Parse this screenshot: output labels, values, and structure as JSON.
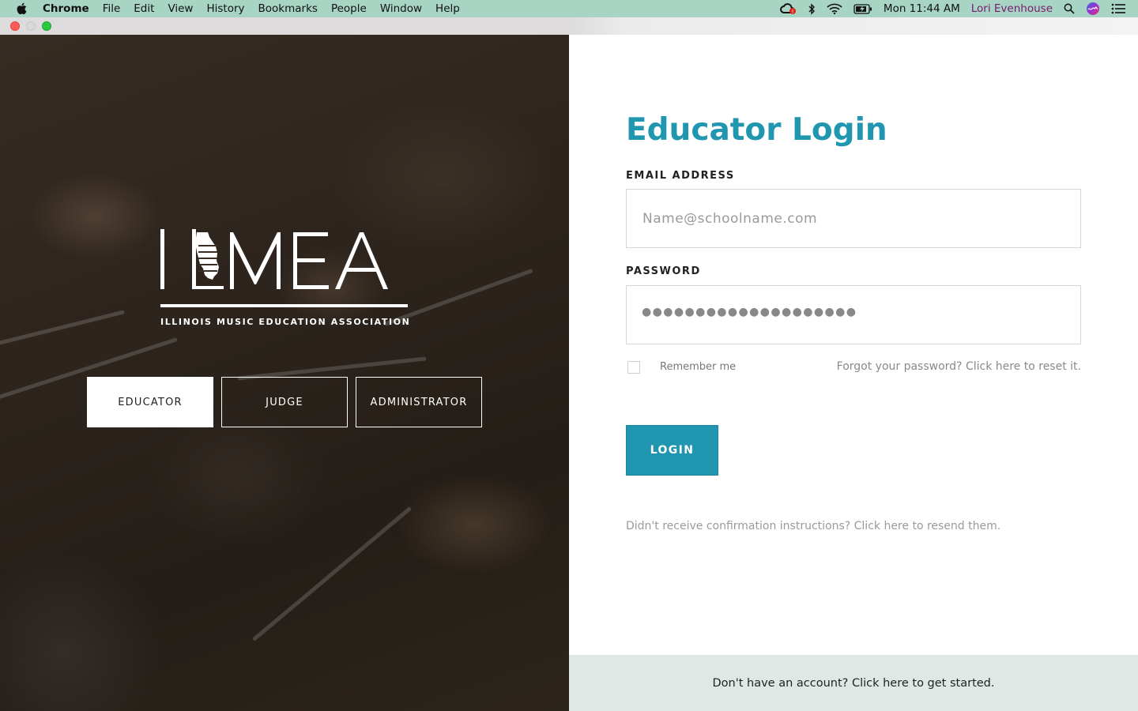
{
  "menubar": {
    "app_name": "Chrome",
    "items": [
      "File",
      "Edit",
      "View",
      "History",
      "Bookmarks",
      "People",
      "Window",
      "Help"
    ],
    "clock": "Mon 11:44 AM",
    "user": "Lori Evenhouse",
    "icons": [
      "apple-icon",
      "creative-cloud-icon",
      "bluetooth-icon",
      "wifi-icon",
      "battery-icon",
      "spotlight-search-icon",
      "siri-icon",
      "notification-center-icon"
    ]
  },
  "hero": {
    "logo_text": "ILMEA",
    "tagline": "ILLINOIS MUSIC EDUCATION ASSOCIATION",
    "roles": [
      {
        "label": "EDUCATOR",
        "active": true
      },
      {
        "label": "JUDGE",
        "active": false
      },
      {
        "label": "ADMINISTRATOR",
        "active": false
      }
    ]
  },
  "login": {
    "title": "Educator Login",
    "email_label": "EMAIL ADDRESS",
    "email_placeholder": "Name@schoolname.com",
    "password_label": "PASSWORD",
    "password_masked": "●●●●●●●●●●●●●●●●●●●●",
    "remember_label": "Remember me",
    "forgot_link": "Forgot your password? Click here to reset it.",
    "submit_label": "LOGIN",
    "resend_link": "Didn't receive confirmation instructions? Click here to resend them."
  },
  "footer": {
    "signup_link": "Don't have an account? Click here to get started."
  },
  "colors": {
    "accent": "#2196b0",
    "menubar_bg": "#a8d4c4",
    "footer_bg": "#e0e8e5",
    "user_name": "#7a1a6e"
  }
}
